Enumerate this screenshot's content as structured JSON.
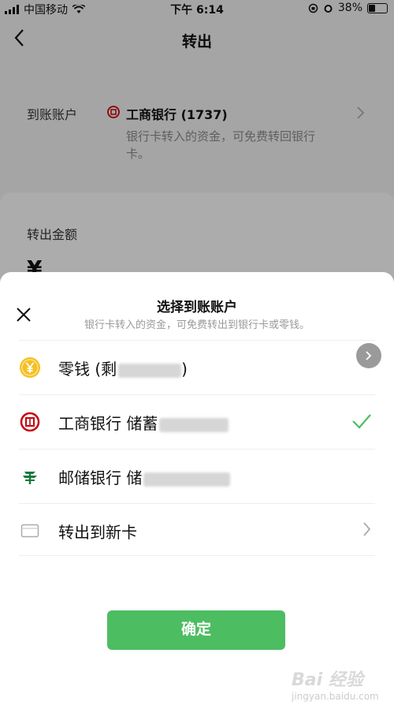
{
  "status_bar": {
    "carrier": "中国移动",
    "time": "下午 6:14",
    "battery": "38%"
  },
  "nav": {
    "title": "转出"
  },
  "account": {
    "label": "到账账户",
    "bank_name": "工商银行 (1737)",
    "description": "银行卡转入的资金，可免费转回银行卡。"
  },
  "amount": {
    "label": "转出金额",
    "currency_symbol": "¥"
  },
  "sheet": {
    "title": "选择到账账户",
    "subtitle": "银行卡转入的资金，可免费转出到银行卡或零钱。",
    "options": [
      {
        "label": "零钱 (剩",
        "suffix": ")",
        "icon": "coin-icon"
      },
      {
        "label": "工商银行 储蓄",
        "icon": "icbc-icon",
        "selected": true
      },
      {
        "label": "邮储银行 储",
        "icon": "postal-bank-icon"
      },
      {
        "label": "转出到新卡",
        "icon": "card-icon"
      }
    ],
    "confirm_label": "确定"
  },
  "watermark": {
    "text": "Bai 经验",
    "sub": "jingyan.baidu.com"
  },
  "colors": {
    "accent": "#4dbd62",
    "icbc_red": "#c7000b",
    "postal_green": "#1a7a3a",
    "coin_yellow": "#f5c024"
  }
}
